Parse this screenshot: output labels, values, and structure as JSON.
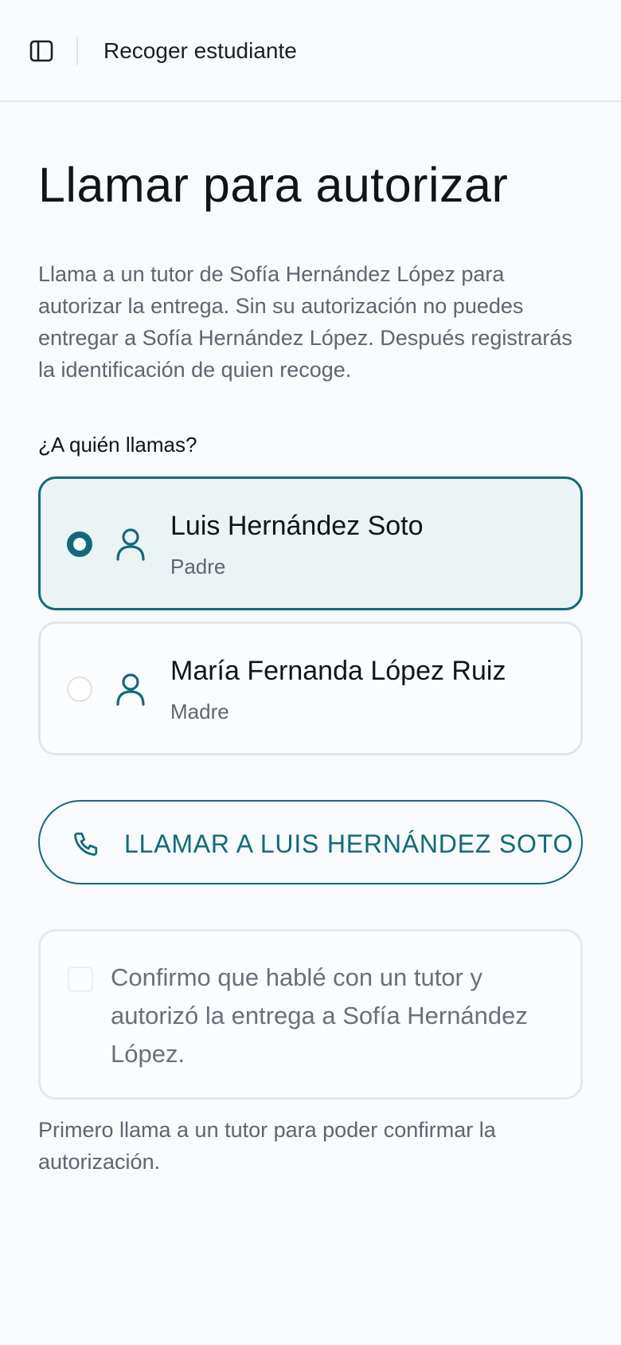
{
  "header": {
    "title": "Recoger estudiante",
    "menu_icon": "sidebar-panel-icon"
  },
  "main": {
    "title": "Llamar para autorizar",
    "intro": "Llama a un tutor de Sofía Hernández López para autorizar la entrega. Sin su autorización no puedes entregar a Sofía Hernández López. Después registrarás la identificación de quien recoge.",
    "question": "¿A quién llamas?",
    "guardians": [
      {
        "name": "Luis Hernández Soto",
        "role": "Padre",
        "selected": true,
        "icon": "user-icon"
      },
      {
        "name": "María Fernanda López Ruiz",
        "role": "Madre",
        "selected": false,
        "icon": "user-icon"
      }
    ],
    "call_button": {
      "label": "LLAMAR A LUIS HERNÁNDEZ SOTO",
      "icon": "phone-icon"
    },
    "confirm": {
      "text": "Confirmo que hablé con un tutor y autorizó la entrega a Sofía Hernández López.",
      "checked": false
    },
    "helper": "Primero llama a un tutor para poder confirmar la autorización."
  },
  "colors": {
    "accent": "#0f6b7c",
    "selected_bg": "#ecf3f5",
    "muted_text": "#5d6670",
    "border": "#e2e6ea",
    "background": "#f8fafc"
  }
}
